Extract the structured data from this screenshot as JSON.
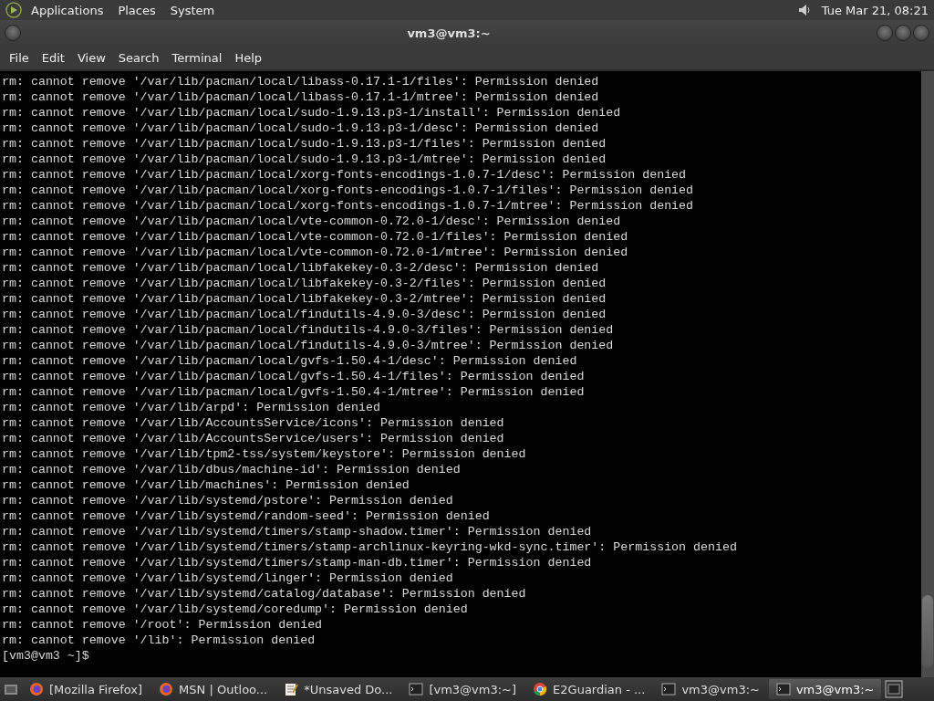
{
  "top_panel": {
    "menus": [
      "Applications",
      "Places",
      "System"
    ],
    "clock": "Tue Mar 21, 08:21"
  },
  "window": {
    "title": "vm3@vm3:~"
  },
  "menubar": [
    "File",
    "Edit",
    "View",
    "Search",
    "Terminal",
    "Help"
  ],
  "terminal": {
    "lines": [
      "rm: cannot remove '/var/lib/pacman/local/libass-0.17.1-1/files': Permission denied",
      "rm: cannot remove '/var/lib/pacman/local/libass-0.17.1-1/mtree': Permission denied",
      "rm: cannot remove '/var/lib/pacman/local/sudo-1.9.13.p3-1/install': Permission denied",
      "rm: cannot remove '/var/lib/pacman/local/sudo-1.9.13.p3-1/desc': Permission denied",
      "rm: cannot remove '/var/lib/pacman/local/sudo-1.9.13.p3-1/files': Permission denied",
      "rm: cannot remove '/var/lib/pacman/local/sudo-1.9.13.p3-1/mtree': Permission denied",
      "rm: cannot remove '/var/lib/pacman/local/xorg-fonts-encodings-1.0.7-1/desc': Permission denied",
      "rm: cannot remove '/var/lib/pacman/local/xorg-fonts-encodings-1.0.7-1/files': Permission denied",
      "rm: cannot remove '/var/lib/pacman/local/xorg-fonts-encodings-1.0.7-1/mtree': Permission denied",
      "rm: cannot remove '/var/lib/pacman/local/vte-common-0.72.0-1/desc': Permission denied",
      "rm: cannot remove '/var/lib/pacman/local/vte-common-0.72.0-1/files': Permission denied",
      "rm: cannot remove '/var/lib/pacman/local/vte-common-0.72.0-1/mtree': Permission denied",
      "rm: cannot remove '/var/lib/pacman/local/libfakekey-0.3-2/desc': Permission denied",
      "rm: cannot remove '/var/lib/pacman/local/libfakekey-0.3-2/files': Permission denied",
      "rm: cannot remove '/var/lib/pacman/local/libfakekey-0.3-2/mtree': Permission denied",
      "rm: cannot remove '/var/lib/pacman/local/findutils-4.9.0-3/desc': Permission denied",
      "rm: cannot remove '/var/lib/pacman/local/findutils-4.9.0-3/files': Permission denied",
      "rm: cannot remove '/var/lib/pacman/local/findutils-4.9.0-3/mtree': Permission denied",
      "rm: cannot remove '/var/lib/pacman/local/gvfs-1.50.4-1/desc': Permission denied",
      "rm: cannot remove '/var/lib/pacman/local/gvfs-1.50.4-1/files': Permission denied",
      "rm: cannot remove '/var/lib/pacman/local/gvfs-1.50.4-1/mtree': Permission denied",
      "rm: cannot remove '/var/lib/arpd': Permission denied",
      "rm: cannot remove '/var/lib/AccountsService/icons': Permission denied",
      "rm: cannot remove '/var/lib/AccountsService/users': Permission denied",
      "rm: cannot remove '/var/lib/tpm2-tss/system/keystore': Permission denied",
      "rm: cannot remove '/var/lib/dbus/machine-id': Permission denied",
      "rm: cannot remove '/var/lib/machines': Permission denied",
      "rm: cannot remove '/var/lib/systemd/pstore': Permission denied",
      "rm: cannot remove '/var/lib/systemd/random-seed': Permission denied",
      "rm: cannot remove '/var/lib/systemd/timers/stamp-shadow.timer': Permission denied",
      "rm: cannot remove '/var/lib/systemd/timers/stamp-archlinux-keyring-wkd-sync.timer': Permission denied",
      "rm: cannot remove '/var/lib/systemd/timers/stamp-man-db.timer': Permission denied",
      "rm: cannot remove '/var/lib/systemd/linger': Permission denied",
      "rm: cannot remove '/var/lib/systemd/catalog/database': Permission denied",
      "rm: cannot remove '/var/lib/systemd/coredump': Permission denied",
      "rm: cannot remove '/root': Permission denied",
      "rm: cannot remove '/lib': Permission denied"
    ],
    "prompt": "[vm3@vm3 ~]$"
  },
  "taskbar": {
    "items": [
      {
        "kind": "firefox",
        "label": "[Mozilla Firefox]",
        "selected": false
      },
      {
        "kind": "firefox",
        "label": "MSN | Outloo...",
        "selected": false
      },
      {
        "kind": "editor",
        "label": "*Unsaved Do...",
        "selected": false
      },
      {
        "kind": "terminal",
        "label": "[vm3@vm3:~]",
        "selected": false
      },
      {
        "kind": "chrome",
        "label": "E2Guardian - ...",
        "selected": false
      },
      {
        "kind": "terminal",
        "label": "vm3@vm3:~",
        "selected": false
      },
      {
        "kind": "terminal",
        "label": "vm3@vm3:~",
        "selected": true
      }
    ]
  }
}
